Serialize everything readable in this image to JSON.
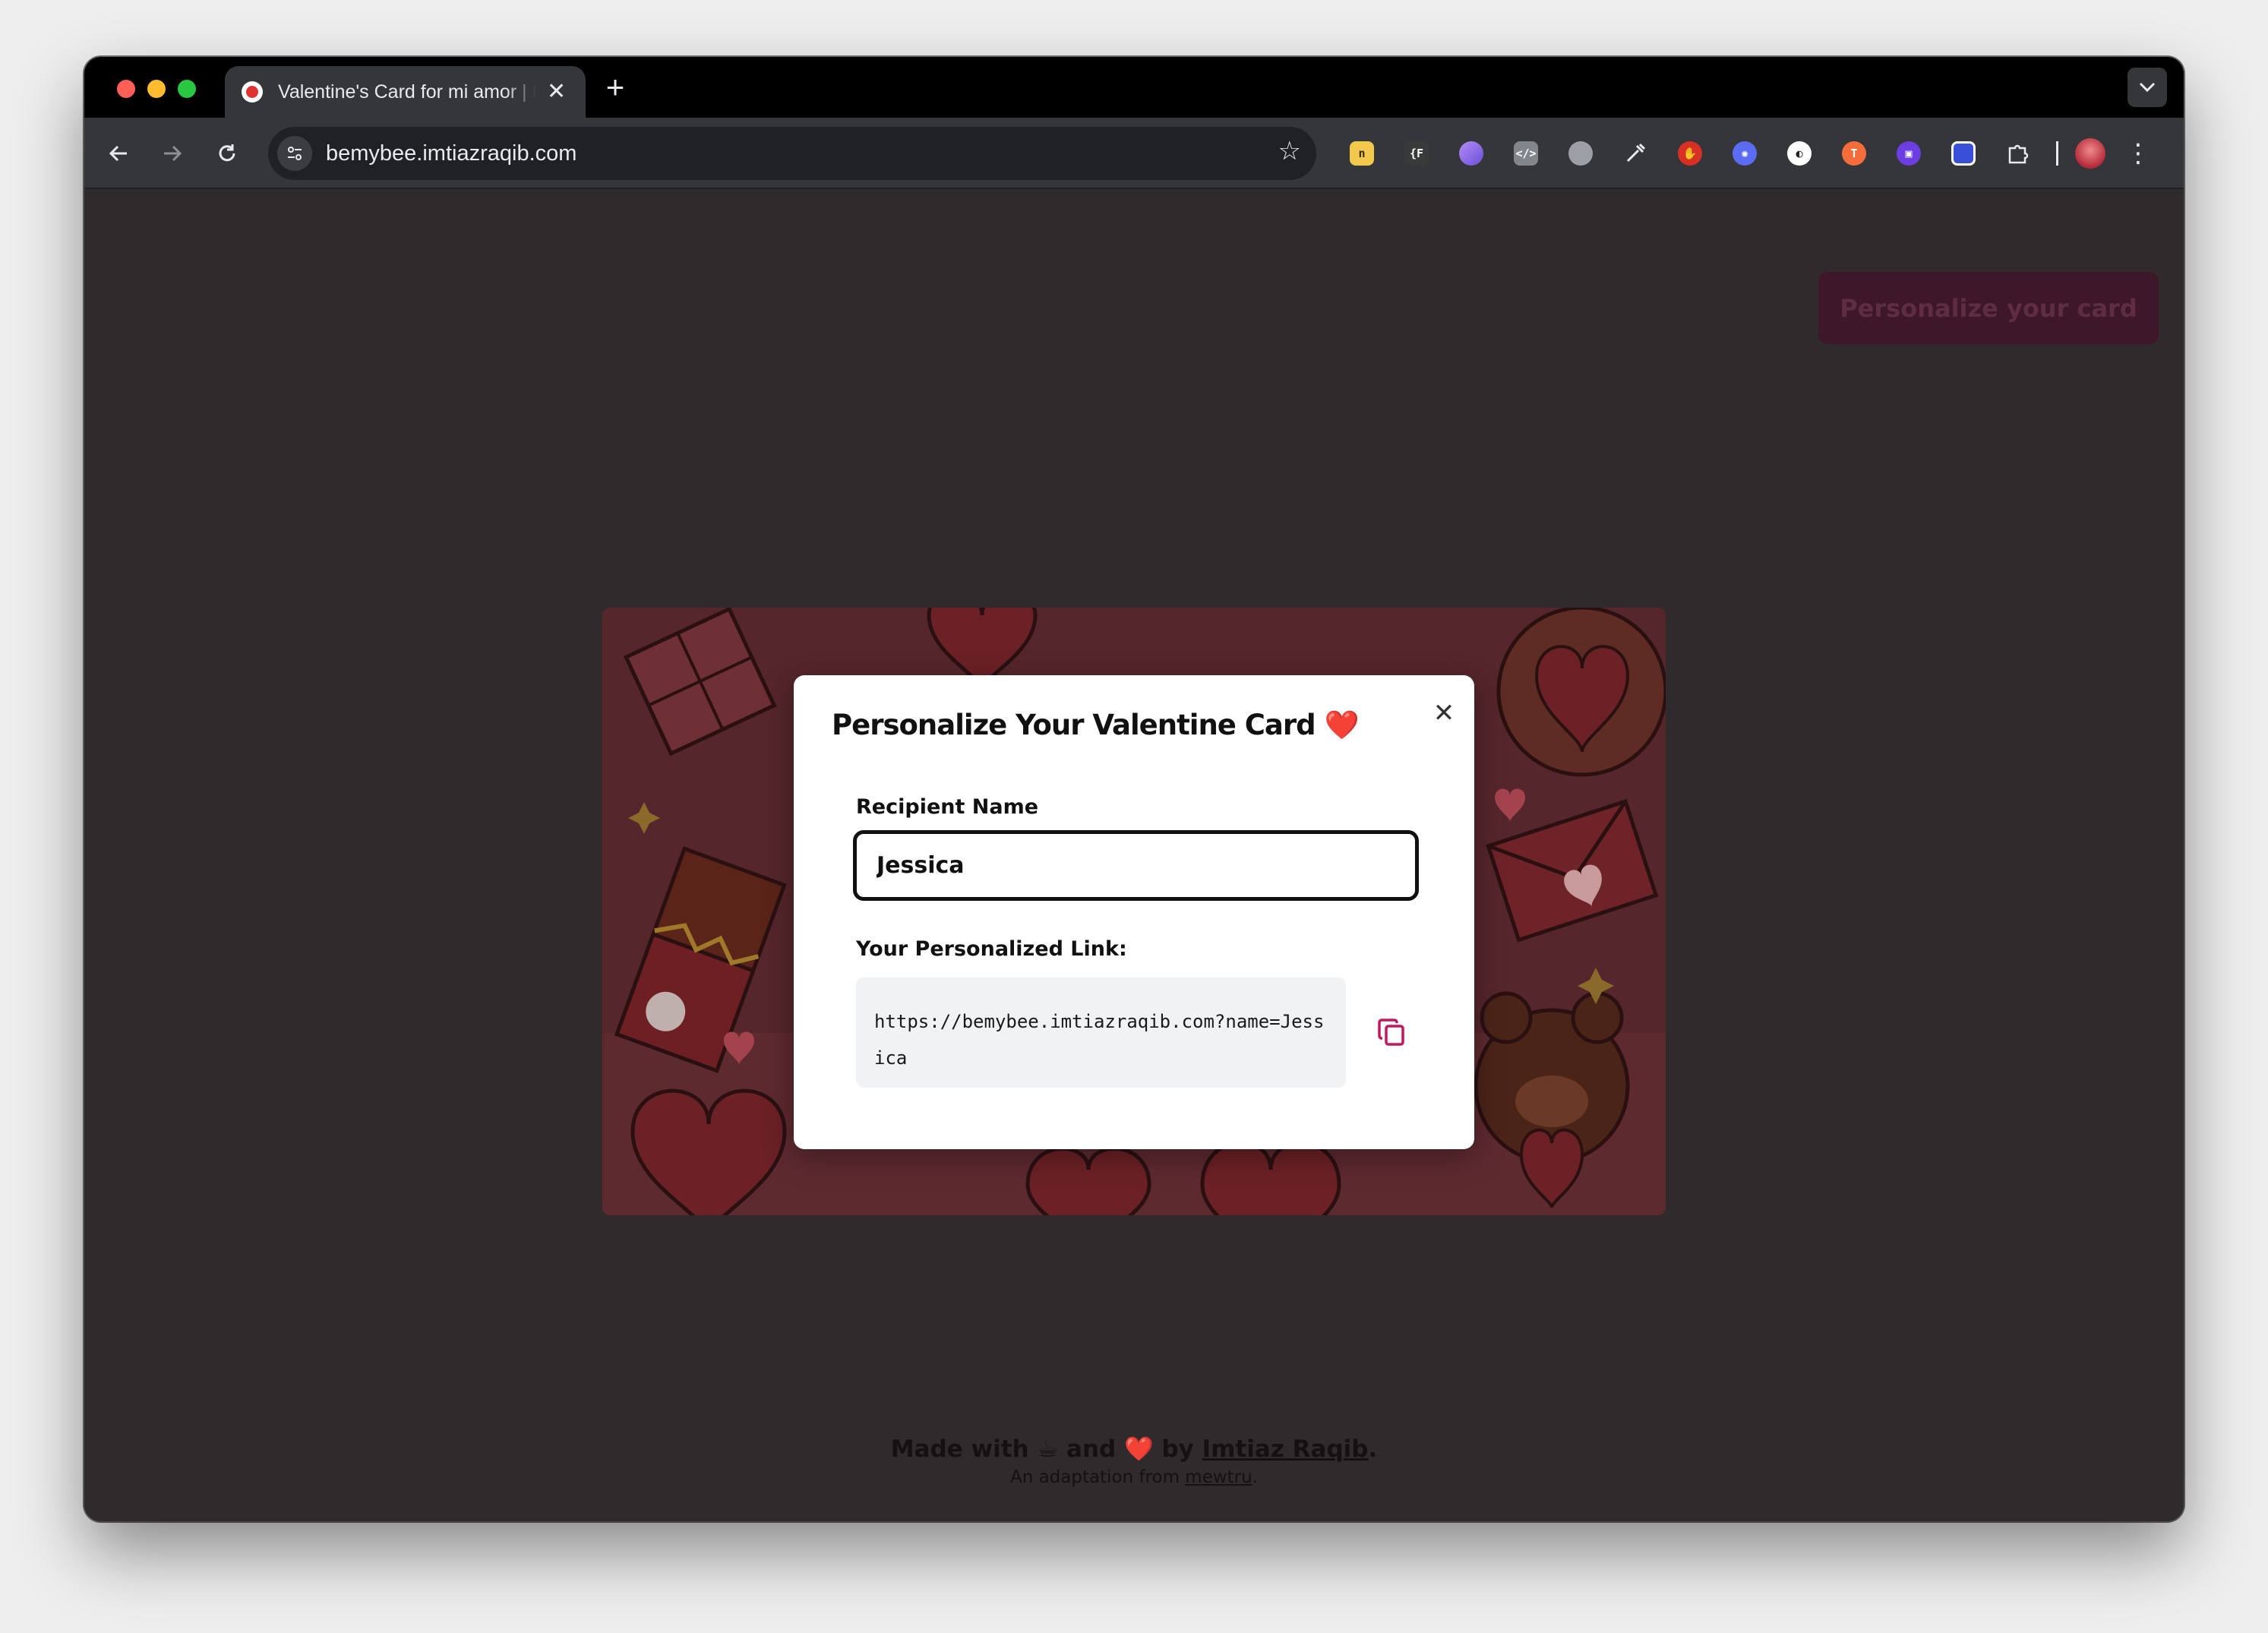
{
  "browser": {
    "tab_title": "Valentine's Card for mi amor | Imtiaz Raqib",
    "tab_close": "✕",
    "new_tab": "+",
    "url": "bemybee.imtiazraqib.com",
    "extensions": [
      {
        "name": "folder-extension-icon",
        "color": "#f2c94c"
      },
      {
        "name": "json-formatter-icon",
        "color": "#3a3a3a"
      },
      {
        "name": "purple-drop-icon",
        "color": "#8a63e8"
      },
      {
        "name": "code-view-icon",
        "color": "#9aa0a6"
      },
      {
        "name": "camera-icon",
        "color": "#9aa0a6"
      },
      {
        "name": "eyedropper-icon",
        "color": "#e8eaed"
      },
      {
        "name": "hand-stop-icon",
        "color": "#d93025"
      },
      {
        "name": "blue-gear-icon",
        "color": "#5b6cf2"
      },
      {
        "name": "white-circle-icon",
        "color": "#ffffff"
      },
      {
        "name": "orange-t-icon",
        "color": "#f46d3b"
      },
      {
        "name": "purple-square-icon",
        "color": "#6c3de0"
      },
      {
        "name": "screen-capture-icon",
        "color": "#4f6cff"
      },
      {
        "name": "puzzle-icon",
        "color": "#e8eaed"
      }
    ]
  },
  "page": {
    "personalize_button": "Personalize your card",
    "modal": {
      "title": "Personalize Your Valentine Card ❤️",
      "close": "✕",
      "recipient_label": "Recipient Name",
      "recipient_value": "Jessica",
      "link_label": "Your Personalized Link:",
      "link_value": "https://bemybee.imtiazraqib.com?name=Jessica"
    },
    "footer": {
      "made_with": "Made with",
      "coffee": "☕",
      "and": "and",
      "heart": "❤️",
      "by": "by",
      "author": "Imtiaz Raqib",
      "period": ".",
      "adaptation": "An adaptation from",
      "source": "mewtru"
    }
  },
  "colors": {
    "accent": "#c2185b",
    "page_background": "#2f2b2c",
    "modal_background": "#ffffff",
    "button_background": "#3e1828"
  }
}
